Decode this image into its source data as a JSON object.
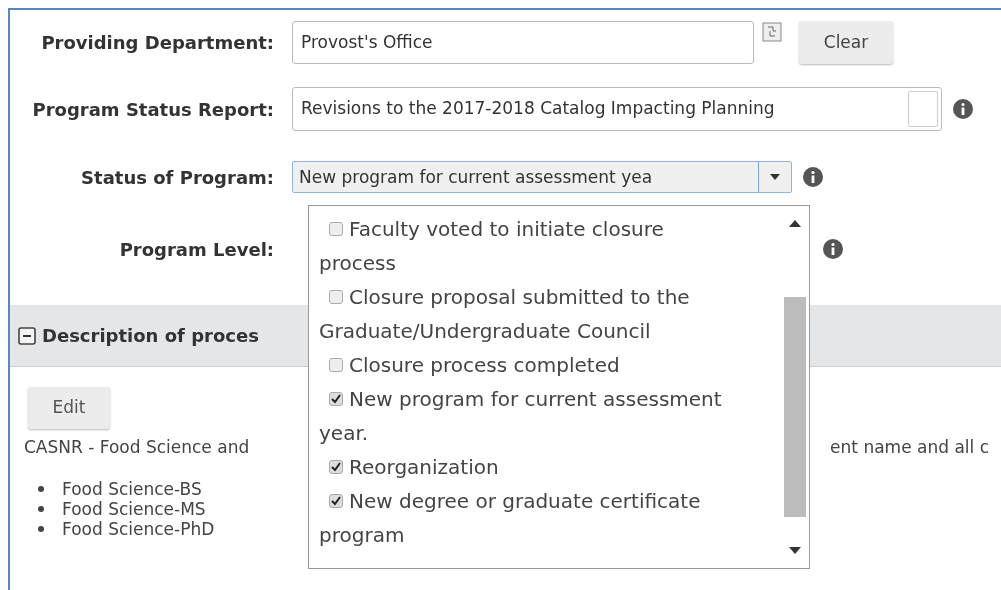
{
  "fields": [
    {
      "kind": "lookup",
      "label": "Providing Department:",
      "value": "Provost's Office",
      "button": "Clear"
    },
    {
      "kind": "textarea",
      "label": "Program Status Report:",
      "value": "Revisions to the 2017-2018 Catalog Impacting Planning"
    },
    {
      "kind": "select",
      "label": "Status of Program:",
      "value": "New program for current assessment yea"
    },
    {
      "kind": "blank",
      "label": "Program Level:"
    }
  ],
  "dropdown": {
    "options": [
      {
        "label": "Faculty voted to initiate closure process",
        "checked": false
      },
      {
        "label": "Closure proposal submitted to the Graduate/Undergraduate Council",
        "checked": false
      },
      {
        "label": "Closure process completed",
        "checked": false
      },
      {
        "label": "New program for current assessment year.",
        "checked": true
      },
      {
        "label": "Reorganization",
        "checked": true
      },
      {
        "label": "New degree or graduate certificate program",
        "checked": true
      }
    ]
  },
  "section": {
    "title": "Description of proces",
    "expanded": true,
    "button": "Edit",
    "text_left": "CASNR - Food Science and",
    "text_right": "ent name and all c",
    "items": [
      "Food Science-BS",
      "Food Science-MS",
      "Food Science-PhD"
    ]
  }
}
